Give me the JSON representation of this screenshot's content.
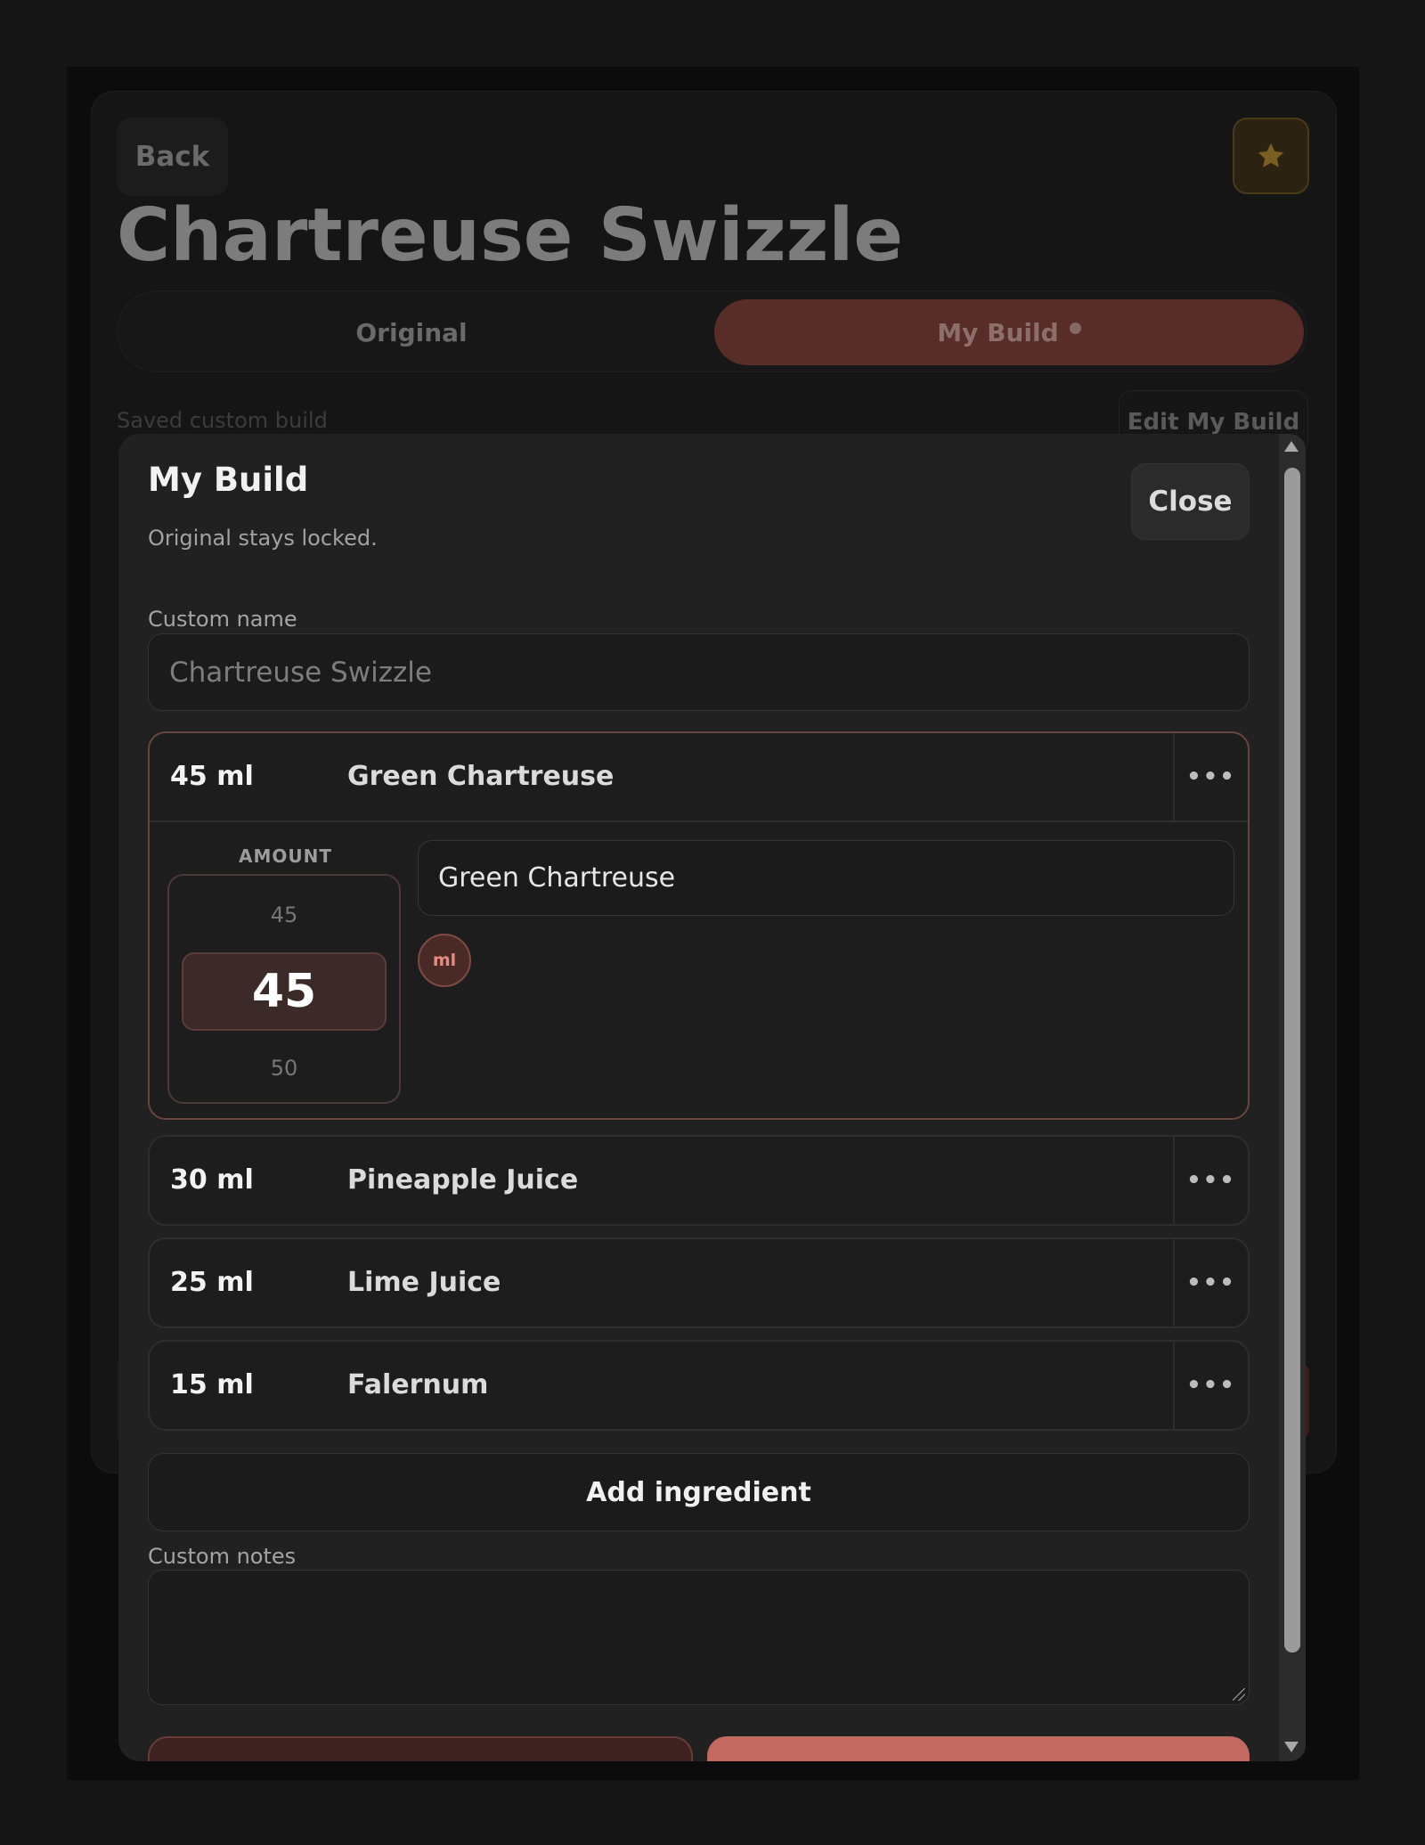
{
  "background": {
    "back_label": "Back",
    "title": "Chartreuse Swizzle",
    "tabs": [
      {
        "label": "Original"
      },
      {
        "label": "My Build"
      }
    ],
    "saved_label": "Saved custom build",
    "edit_label": "Edit My Build",
    "colors": {
      "active_tab": "#582c27",
      "favorite": "#4a3a17"
    }
  },
  "modal": {
    "title": "My Build",
    "subtitle": "Original stays locked.",
    "close_label": "Close",
    "custom_name_label": "Custom name",
    "custom_name_placeholder": "Chartreuse Swizzle",
    "ingredients": [
      {
        "amount": "45 ml",
        "name": "Green Chartreuse",
        "expanded": true,
        "editor": {
          "amount_label": "AMOUNT",
          "picker_prev": "45",
          "picker_value": "45",
          "picker_next": "50",
          "name_value": "Green Chartreuse",
          "unit": "ml"
        }
      },
      {
        "amount": "30 ml",
        "name": "Pineapple Juice"
      },
      {
        "amount": "25 ml",
        "name": "Lime Juice"
      },
      {
        "amount": "15 ml",
        "name": "Falernum"
      }
    ],
    "more_label": "•••",
    "add_ingredient_label": "Add ingredient",
    "custom_notes_label": "Custom notes",
    "custom_notes_value": "",
    "colors": {
      "accent": "#c26a60",
      "selected_border": "#6a4540"
    }
  }
}
